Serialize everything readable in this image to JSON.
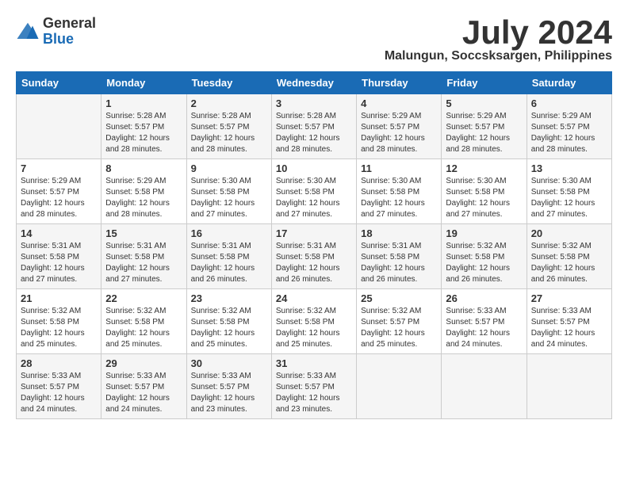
{
  "logo": {
    "general": "General",
    "blue": "Blue"
  },
  "title": {
    "month_year": "July 2024",
    "location": "Malungun, Soccsksargen, Philippines"
  },
  "days_of_week": [
    "Sunday",
    "Monday",
    "Tuesday",
    "Wednesday",
    "Thursday",
    "Friday",
    "Saturday"
  ],
  "weeks": [
    [
      {
        "day": "",
        "sunrise": "",
        "sunset": "",
        "daylight": ""
      },
      {
        "day": "1",
        "sunrise": "Sunrise: 5:28 AM",
        "sunset": "Sunset: 5:57 PM",
        "daylight": "Daylight: 12 hours and 28 minutes."
      },
      {
        "day": "2",
        "sunrise": "Sunrise: 5:28 AM",
        "sunset": "Sunset: 5:57 PM",
        "daylight": "Daylight: 12 hours and 28 minutes."
      },
      {
        "day": "3",
        "sunrise": "Sunrise: 5:28 AM",
        "sunset": "Sunset: 5:57 PM",
        "daylight": "Daylight: 12 hours and 28 minutes."
      },
      {
        "day": "4",
        "sunrise": "Sunrise: 5:29 AM",
        "sunset": "Sunset: 5:57 PM",
        "daylight": "Daylight: 12 hours and 28 minutes."
      },
      {
        "day": "5",
        "sunrise": "Sunrise: 5:29 AM",
        "sunset": "Sunset: 5:57 PM",
        "daylight": "Daylight: 12 hours and 28 minutes."
      },
      {
        "day": "6",
        "sunrise": "Sunrise: 5:29 AM",
        "sunset": "Sunset: 5:57 PM",
        "daylight": "Daylight: 12 hours and 28 minutes."
      }
    ],
    [
      {
        "day": "7",
        "sunrise": "Sunrise: 5:29 AM",
        "sunset": "Sunset: 5:57 PM",
        "daylight": "Daylight: 12 hours and 28 minutes."
      },
      {
        "day": "8",
        "sunrise": "Sunrise: 5:29 AM",
        "sunset": "Sunset: 5:58 PM",
        "daylight": "Daylight: 12 hours and 28 minutes."
      },
      {
        "day": "9",
        "sunrise": "Sunrise: 5:30 AM",
        "sunset": "Sunset: 5:58 PM",
        "daylight": "Daylight: 12 hours and 27 minutes."
      },
      {
        "day": "10",
        "sunrise": "Sunrise: 5:30 AM",
        "sunset": "Sunset: 5:58 PM",
        "daylight": "Daylight: 12 hours and 27 minutes."
      },
      {
        "day": "11",
        "sunrise": "Sunrise: 5:30 AM",
        "sunset": "Sunset: 5:58 PM",
        "daylight": "Daylight: 12 hours and 27 minutes."
      },
      {
        "day": "12",
        "sunrise": "Sunrise: 5:30 AM",
        "sunset": "Sunset: 5:58 PM",
        "daylight": "Daylight: 12 hours and 27 minutes."
      },
      {
        "day": "13",
        "sunrise": "Sunrise: 5:30 AM",
        "sunset": "Sunset: 5:58 PM",
        "daylight": "Daylight: 12 hours and 27 minutes."
      }
    ],
    [
      {
        "day": "14",
        "sunrise": "Sunrise: 5:31 AM",
        "sunset": "Sunset: 5:58 PM",
        "daylight": "Daylight: 12 hours and 27 minutes."
      },
      {
        "day": "15",
        "sunrise": "Sunrise: 5:31 AM",
        "sunset": "Sunset: 5:58 PM",
        "daylight": "Daylight: 12 hours and 27 minutes."
      },
      {
        "day": "16",
        "sunrise": "Sunrise: 5:31 AM",
        "sunset": "Sunset: 5:58 PM",
        "daylight": "Daylight: 12 hours and 26 minutes."
      },
      {
        "day": "17",
        "sunrise": "Sunrise: 5:31 AM",
        "sunset": "Sunset: 5:58 PM",
        "daylight": "Daylight: 12 hours and 26 minutes."
      },
      {
        "day": "18",
        "sunrise": "Sunrise: 5:31 AM",
        "sunset": "Sunset: 5:58 PM",
        "daylight": "Daylight: 12 hours and 26 minutes."
      },
      {
        "day": "19",
        "sunrise": "Sunrise: 5:32 AM",
        "sunset": "Sunset: 5:58 PM",
        "daylight": "Daylight: 12 hours and 26 minutes."
      },
      {
        "day": "20",
        "sunrise": "Sunrise: 5:32 AM",
        "sunset": "Sunset: 5:58 PM",
        "daylight": "Daylight: 12 hours and 26 minutes."
      }
    ],
    [
      {
        "day": "21",
        "sunrise": "Sunrise: 5:32 AM",
        "sunset": "Sunset: 5:58 PM",
        "daylight": "Daylight: 12 hours and 25 minutes."
      },
      {
        "day": "22",
        "sunrise": "Sunrise: 5:32 AM",
        "sunset": "Sunset: 5:58 PM",
        "daylight": "Daylight: 12 hours and 25 minutes."
      },
      {
        "day": "23",
        "sunrise": "Sunrise: 5:32 AM",
        "sunset": "Sunset: 5:58 PM",
        "daylight": "Daylight: 12 hours and 25 minutes."
      },
      {
        "day": "24",
        "sunrise": "Sunrise: 5:32 AM",
        "sunset": "Sunset: 5:58 PM",
        "daylight": "Daylight: 12 hours and 25 minutes."
      },
      {
        "day": "25",
        "sunrise": "Sunrise: 5:32 AM",
        "sunset": "Sunset: 5:57 PM",
        "daylight": "Daylight: 12 hours and 25 minutes."
      },
      {
        "day": "26",
        "sunrise": "Sunrise: 5:33 AM",
        "sunset": "Sunset: 5:57 PM",
        "daylight": "Daylight: 12 hours and 24 minutes."
      },
      {
        "day": "27",
        "sunrise": "Sunrise: 5:33 AM",
        "sunset": "Sunset: 5:57 PM",
        "daylight": "Daylight: 12 hours and 24 minutes."
      }
    ],
    [
      {
        "day": "28",
        "sunrise": "Sunrise: 5:33 AM",
        "sunset": "Sunset: 5:57 PM",
        "daylight": "Daylight: 12 hours and 24 minutes."
      },
      {
        "day": "29",
        "sunrise": "Sunrise: 5:33 AM",
        "sunset": "Sunset: 5:57 PM",
        "daylight": "Daylight: 12 hours and 24 minutes."
      },
      {
        "day": "30",
        "sunrise": "Sunrise: 5:33 AM",
        "sunset": "Sunset: 5:57 PM",
        "daylight": "Daylight: 12 hours and 23 minutes."
      },
      {
        "day": "31",
        "sunrise": "Sunrise: 5:33 AM",
        "sunset": "Sunset: 5:57 PM",
        "daylight": "Daylight: 12 hours and 23 minutes."
      },
      {
        "day": "",
        "sunrise": "",
        "sunset": "",
        "daylight": ""
      },
      {
        "day": "",
        "sunrise": "",
        "sunset": "",
        "daylight": ""
      },
      {
        "day": "",
        "sunrise": "",
        "sunset": "",
        "daylight": ""
      }
    ]
  ]
}
